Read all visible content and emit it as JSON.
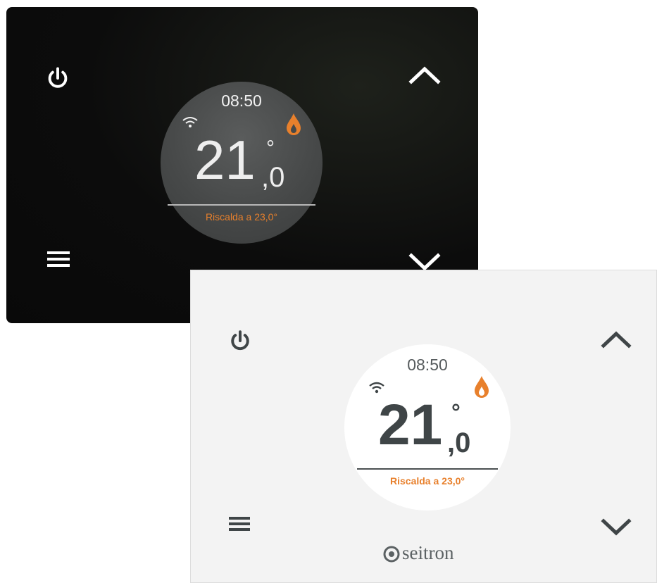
{
  "dark_panel": {
    "time": "08:50",
    "temperature_integer": "21",
    "temperature_decimal": ",0",
    "degree_symbol": "°",
    "status": "Riscalda a 23,0°"
  },
  "light_panel": {
    "time": "08:50",
    "temperature_integer": "21",
    "temperature_decimal": ",0",
    "degree_symbol": "°",
    "status": "Riscalda a 23,0°",
    "brand": "seitron"
  },
  "colors": {
    "accent_orange": "#e8802c",
    "dark_bg": "#0c0c0c",
    "light_bg": "#f3f3f3",
    "light_icon": "#3f4547"
  },
  "icons": [
    "power-icon",
    "menu-icon",
    "chevron-up-icon",
    "chevron-down-icon",
    "wifi-icon",
    "flame-icon"
  ]
}
